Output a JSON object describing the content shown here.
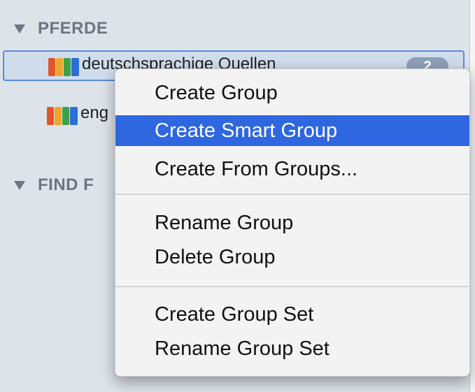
{
  "sidebar": {
    "sections": [
      {
        "header": "PFERDE"
      },
      {
        "header": "FIND F"
      }
    ],
    "items": [
      {
        "label": "deutschsprachige Quellen",
        "count": "2",
        "selected": true
      },
      {
        "label": "eng"
      }
    ]
  },
  "context_menu": {
    "groups": [
      [
        "Create Group",
        "Create Smart Group",
        "Create From Groups..."
      ],
      [
        "Rename Group",
        "Delete Group"
      ],
      [
        "Create Group Set",
        "Rename Group Set"
      ]
    ],
    "highlighted": "Create Smart Group"
  },
  "colors": {
    "sidebar_bg": "#dee3ea",
    "selection_border": "#5a8bd9",
    "menu_highlight": "#2e67e0",
    "header_text": "#6c7682",
    "icon_spines": [
      "#e0542e",
      "#f0a52a",
      "#3ea14a",
      "#2d6ed6"
    ]
  },
  "icons": {
    "section_toggle": "disclosure-triangle-down",
    "library": "colored-books-icon"
  }
}
